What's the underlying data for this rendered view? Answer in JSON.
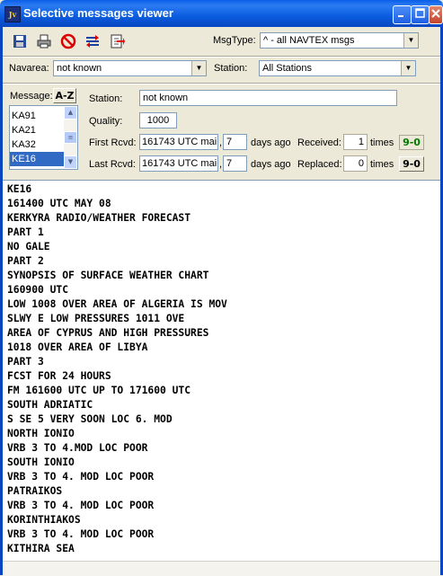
{
  "window": {
    "title": "Selective messages viewer",
    "icon_text": "Jv"
  },
  "toolbar": {
    "buttons": [
      "save-icon",
      "print-icon",
      "delete-icon",
      "filter-icon",
      "export-icon"
    ],
    "msgtype_label": "MsgType:",
    "msgtype_value": "^ - all NAVTEX msgs"
  },
  "filters": {
    "navarea_label": "Navarea:",
    "navarea_value": "not known",
    "station_label": "Station:",
    "station_value": "All Stations"
  },
  "message": {
    "label": "Message:",
    "sort_label": "A-Z",
    "list": [
      "KA91",
      "KA21",
      "KA32",
      "KE16"
    ],
    "selected": "KE16"
  },
  "details": {
    "station_label": "Station:",
    "station_value": "not known",
    "quality_label": "Quality:",
    "quality_value": "1000",
    "first_label": "First Rcvd:",
    "first_value": "161743 UTC mai",
    "first_days": "7",
    "days_ago": "days ago",
    "received_label": "Received:",
    "received_value": "1",
    "times": "times",
    "received_badge": "9-0",
    "last_label": "Last Rcvd:",
    "last_value": "161743 UTC mai",
    "last_days": "7",
    "replaced_label": "Replaced:",
    "replaced_value": "0",
    "replaced_badge": "9-0",
    "comma": ","
  },
  "message_text": [
    "KE16",
    "161400 UTC MAY 08",
    "KERKYRA RADIO/WEATHER FORECAST",
    "PART 1",
    "NO GALE",
    "PART 2",
    "SYNOPSIS OF SURFACE WEATHER CHART",
    "160900 UTC",
    "LOW 1008 OVER AREA OF ALGERIA IS MOV",
    "SLWY E LOW PRESSURES 1011 OVE",
    "AREA OF CYPRUS AND HIGH PRESSURES",
    "1018 OVER AREA OF LIBYA",
    "PART 3",
    "FCST FOR 24 HOURS",
    "FM 161600 UTC UP TO 171600 UTC",
    "SOUTH ADRIATIC",
    "S SE 5 VERY SOON LOC 6. MOD",
    "NORTH IONIO",
    "VRB 3 TO 4.MOD LOC POOR",
    "SOUTH IONIO",
    "VRB 3 TO 4. MOD LOC POOR",
    "PATRAIKOS",
    "VRB 3 TO 4. MOD LOC POOR",
    "KORINTHIAKOS",
    "VRB 3 TO 4. MOD LOC POOR",
    "KITHIRA SEA"
  ]
}
